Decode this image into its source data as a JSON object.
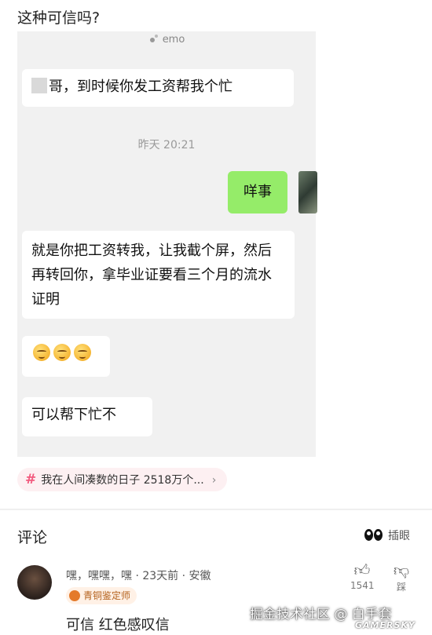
{
  "post": {
    "question": "这种可信吗?"
  },
  "chat": {
    "header": "emo",
    "messages": [
      {
        "from": "other",
        "text": "哥，到时候你发工资帮我个忙"
      },
      {
        "from": "me",
        "text": "咩事"
      },
      {
        "from": "other",
        "text": "就是你把工资转我，让我截个屏，然后再转回你，拿毕业证要看三个月的流水证明"
      },
      {
        "from": "other",
        "type": "emoji",
        "icon": "grimace-emoji",
        "count": 3
      },
      {
        "from": "other",
        "text": "可以帮下忙不"
      }
    ],
    "time": "昨天 20:21"
  },
  "topic": {
    "text": "我在人间凑数的日子 2518万个...",
    "icon": "hash-icon"
  },
  "comments": {
    "title": "评论",
    "insert_label": "插眼",
    "item": {
      "user_line": "嘿，嘿嘿，嘿 · 23天前 · 安徽",
      "badge": "青铜鉴定师",
      "likes": "1541",
      "dislike_label": "踩",
      "text": "可信  红色感叹信"
    }
  },
  "watermark": {
    "text": "掘金技术社区 @ 白手套",
    "brand": "GAMERSKY"
  },
  "colors": {
    "mine_bubble": "#95ec69",
    "chat_bg": "#f1f1f1",
    "topic_hash": "#f25b7e"
  }
}
